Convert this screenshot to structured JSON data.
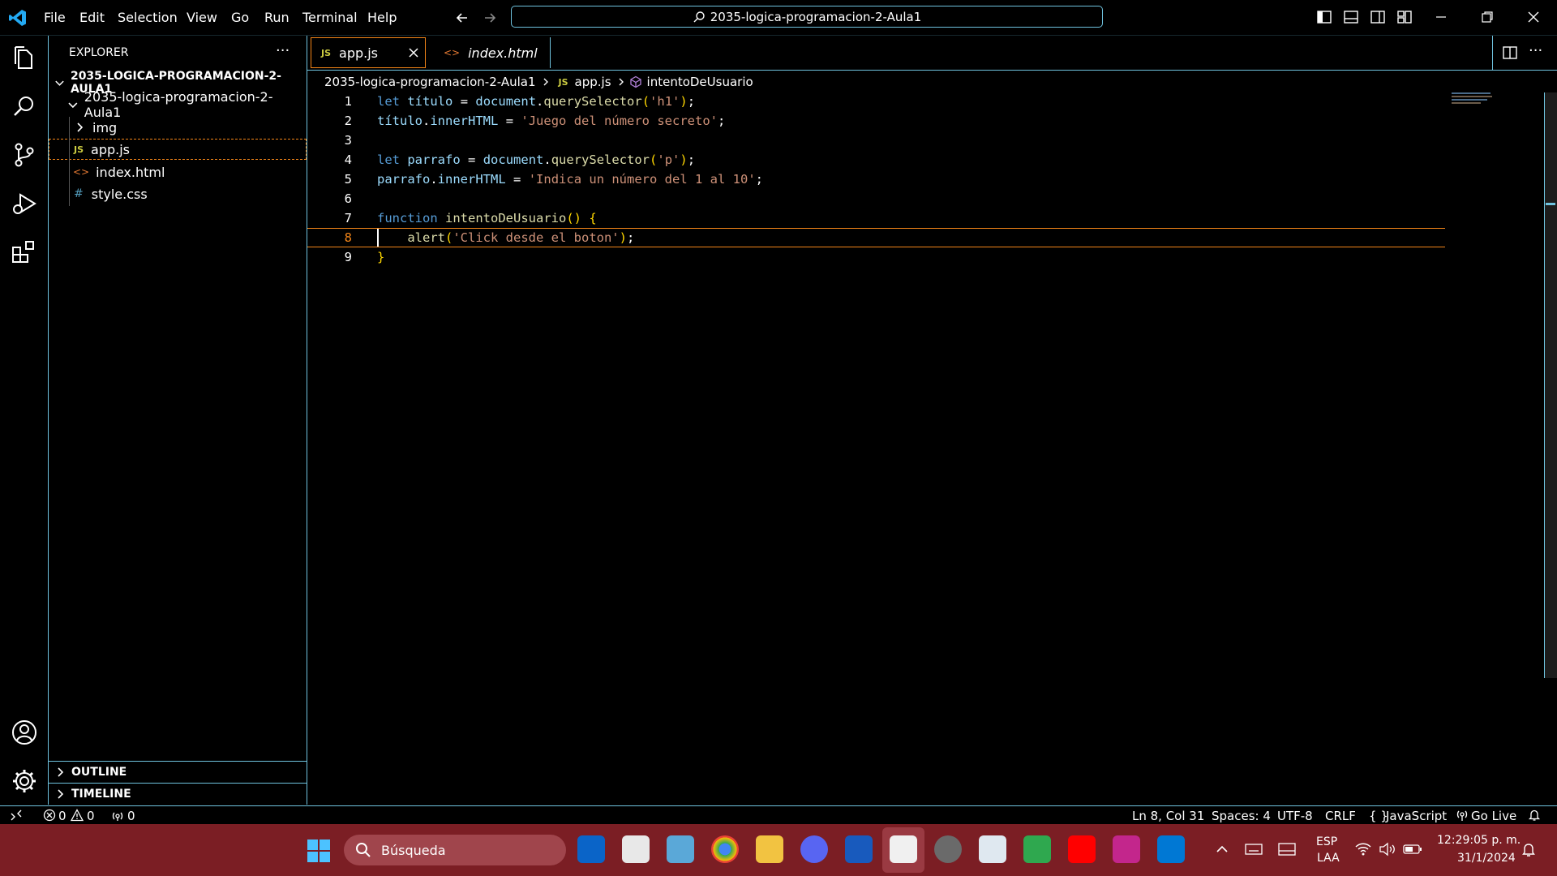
{
  "menu": [
    "File",
    "Edit",
    "Selection",
    "View",
    "Go",
    "Run",
    "Terminal",
    "Help"
  ],
  "command_center": "2035-logica-programacion-2-Aula1",
  "colors": {
    "accent": "#6fc3df",
    "selection": "#f38518",
    "keyword": "#569cd6",
    "variable": "#9cdcfe",
    "function": "#dcdcaa",
    "string": "#ce9178",
    "taskbar": "#7b1e24"
  },
  "sidebar": {
    "title": "EXPLORER",
    "more": "···",
    "root": "2035-LOGICA-PROGRAMACION-2-AULA1",
    "folder": "2035-logica-programacion-2-Aula1",
    "items": [
      {
        "label": "img",
        "icon": "chevron-right-icon"
      },
      {
        "label": "app.js",
        "icon": "js-icon",
        "badge": "JS"
      },
      {
        "label": "index.html",
        "icon": "html-icon",
        "badge": "<>"
      },
      {
        "label": "style.css",
        "icon": "css-icon",
        "badge": "#"
      }
    ],
    "outline": "OUTLINE",
    "timeline": "TIMELINE"
  },
  "tabs": [
    {
      "label": "app.js",
      "badge": "JS",
      "active": true
    },
    {
      "label": "index.html",
      "badge": "<>",
      "active": false
    }
  ],
  "breadcrumb": {
    "folder": "2035-logica-programacion-2-Aula1",
    "file": "app.js",
    "file_badge": "JS",
    "symbol": "intentoDeUsuario"
  },
  "code": [
    {
      "n": "1",
      "text": "let título = document.querySelector('h1');"
    },
    {
      "n": "2",
      "text": "título.innerHTML = 'Juego del número secreto';"
    },
    {
      "n": "3",
      "text": ""
    },
    {
      "n": "4",
      "text": "let parrafo = document.querySelector('p');"
    },
    {
      "n": "5",
      "text": "parrafo.innerHTML = 'Indica un número del 1 al 10';"
    },
    {
      "n": "6",
      "text": ""
    },
    {
      "n": "7",
      "text": "function intentoDeUsuario() {"
    },
    {
      "n": "8",
      "text": "    alert('Click desde el boton');"
    },
    {
      "n": "9",
      "text": "}"
    }
  ],
  "status": {
    "errors": "0",
    "warnings": "0",
    "ports": "0",
    "position": "Ln 8, Col 31",
    "spaces": "Spaces: 4",
    "encoding": "UTF-8",
    "eol": "CRLF",
    "language": "JavaScript",
    "golive": "Go Live"
  },
  "taskbar": {
    "search_placeholder": "Búsqueda",
    "lang1": "ESP",
    "lang2": "LAA",
    "time": "12:29:05 p. m.",
    "date": "31/1/2024"
  }
}
